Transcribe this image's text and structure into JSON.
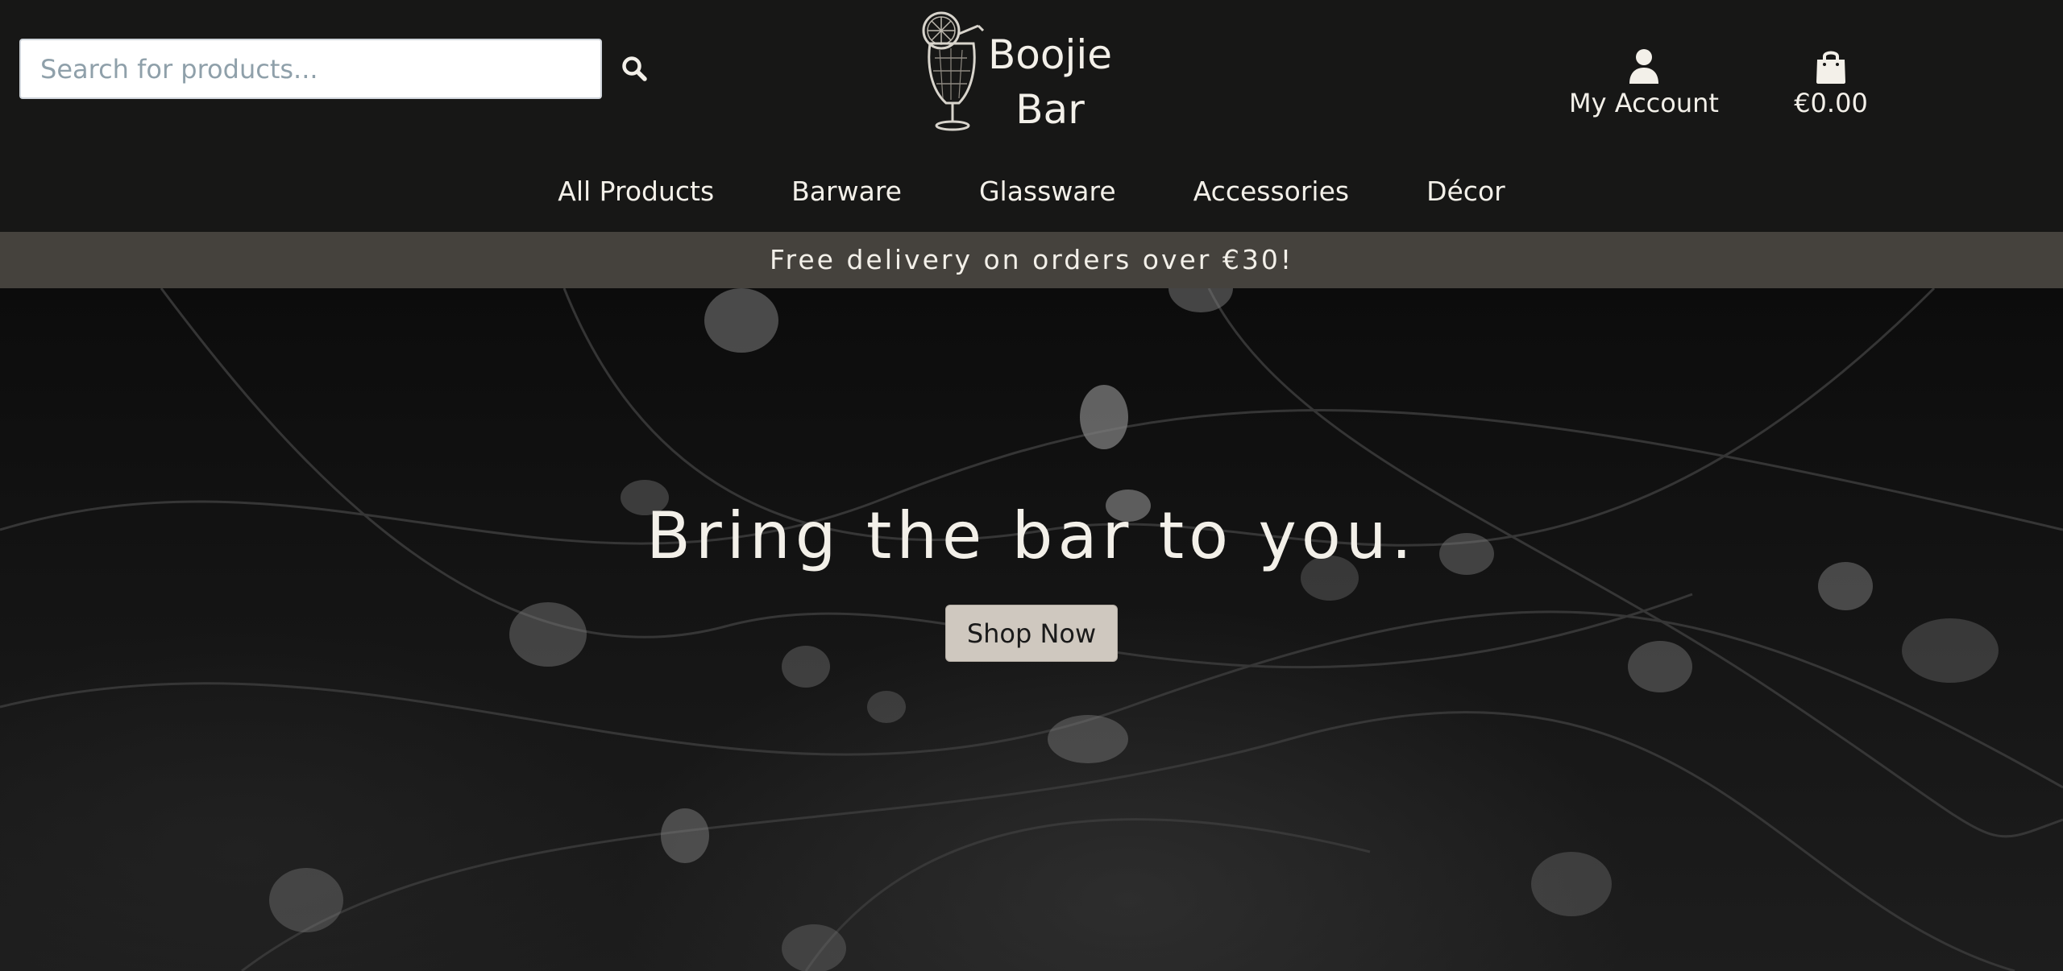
{
  "header": {
    "search": {
      "placeholder": "Search for products...",
      "value": ""
    },
    "brand": {
      "name": "Boojie\nBar"
    },
    "account": {
      "label": "My Account"
    },
    "cart": {
      "total": "€0.00"
    }
  },
  "nav": {
    "items": [
      {
        "label": "All Products"
      },
      {
        "label": "Barware"
      },
      {
        "label": "Glassware"
      },
      {
        "label": "Accessories"
      },
      {
        "label": "Décor"
      }
    ]
  },
  "promo": {
    "text": "Free delivery on orders over €30!"
  },
  "hero": {
    "title": "Bring the bar to you.",
    "cta_label": "Shop Now"
  },
  "icons": {
    "search": "search-icon",
    "account": "user-icon",
    "cart": "shopping-bag-icon",
    "logo": "cocktail-glass-logo"
  },
  "colors": {
    "header_bg": "#171716",
    "promo_bg": "#45423d",
    "text_light": "#f3f0e9",
    "cta_bg": "#cfc8bf"
  }
}
